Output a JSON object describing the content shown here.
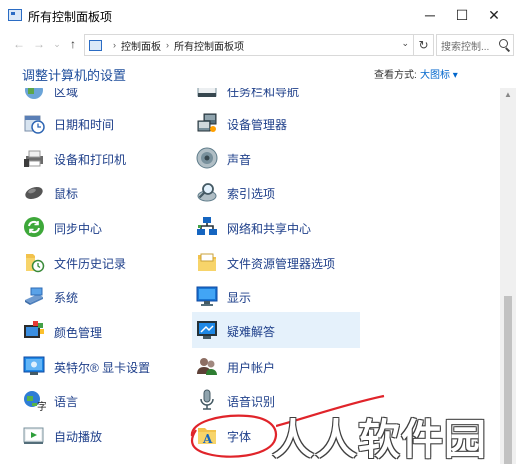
{
  "window": {
    "title": "所有控制面板项",
    "minimize": "─",
    "maximize": "☐",
    "close": "✕"
  },
  "address": {
    "breadcrumbs": [
      "控制面板",
      "所有控制面板项"
    ],
    "separator": "›",
    "search_placeholder": "搜索控制...",
    "back": "←",
    "forward": "→",
    "dropdown": "⌄",
    "up": "↑",
    "refresh": "↻",
    "addr_drop": "⌄"
  },
  "header": {
    "title": "调整计算机的设置",
    "view_label": "查看方式:",
    "view_value": "大图标 ▾"
  },
  "items_left": [
    {
      "label": "区域",
      "icon": "region-icon"
    },
    {
      "label": "日期和时间",
      "icon": "clock-icon"
    },
    {
      "label": "设备和打印机",
      "icon": "printer-icon"
    },
    {
      "label": "鼠标",
      "icon": "mouse-icon"
    },
    {
      "label": "同步中心",
      "icon": "sync-icon"
    },
    {
      "label": "文件历史记录",
      "icon": "file-history-icon"
    },
    {
      "label": "系统",
      "icon": "system-icon"
    },
    {
      "label": "颜色管理",
      "icon": "color-management-icon"
    },
    {
      "label": "英特尔® 显卡设置",
      "icon": "intel-graphics-icon"
    },
    {
      "label": "语言",
      "icon": "language-icon"
    },
    {
      "label": "自动播放",
      "icon": "autoplay-icon"
    }
  ],
  "items_right": [
    {
      "label": "任务栏和导航",
      "icon": "taskbar-icon"
    },
    {
      "label": "设备管理器",
      "icon": "device-manager-icon"
    },
    {
      "label": "声音",
      "icon": "sound-icon"
    },
    {
      "label": "索引选项",
      "icon": "indexing-icon"
    },
    {
      "label": "网络和共享中心",
      "icon": "network-icon"
    },
    {
      "label": "文件资源管理器选项",
      "icon": "folder-options-icon"
    },
    {
      "label": "显示",
      "icon": "display-icon"
    },
    {
      "label": "疑难解答",
      "icon": "troubleshooting-icon"
    },
    {
      "label": "用户帐户",
      "icon": "user-accounts-icon"
    },
    {
      "label": "语音识别",
      "icon": "microphone-icon"
    },
    {
      "label": "字体",
      "icon": "fonts-icon"
    }
  ],
  "highlighted_item": "疑难解答",
  "annotation_color": "#e0242a",
  "watermark": "人人软件园"
}
